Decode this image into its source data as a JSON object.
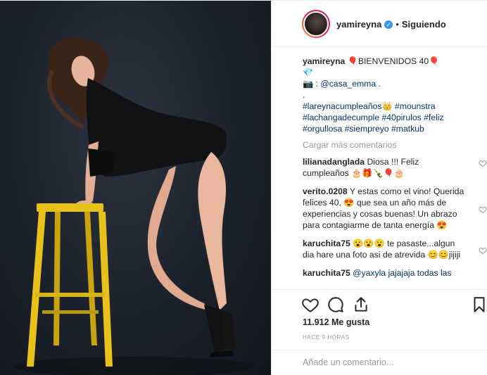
{
  "post": {
    "author": "yamireyna",
    "follow_status": "Siguiendo",
    "dot": "•",
    "caption": {
      "line1": "🎈BIENVENIDOS 40🎈",
      "line2": "💎",
      "line3_prefix": "📷 : ",
      "line3_mention": "@casa_emma",
      "line3_suffix": " .",
      "line4": ".",
      "hashtags_line1a": "#lareynacumpleaños👑",
      "hashtags_line1b": "#mounstra",
      "hashtags_line2a": "#lachangadecumple",
      "hashtags_line2b": "#40pirulos",
      "hashtags_line2c": "#feliz",
      "hashtags_line3a": "#orgullosa",
      "hashtags_line3b": "#siempreyo",
      "hashtags_line3c": "#matkub"
    },
    "load_more": "Cargar más comentarios",
    "comments": [
      {
        "user": "lilianadanglada",
        "text": "Diosa !!! Feliz cumpleaños 🎂🎁🍾🎈🎂"
      },
      {
        "user": "verito.0208",
        "text": "Y estas como el vino! Querida felices 40, 😍 que sea un año más de experiencias y cosas buenas! Un abrazo para contagiarme de tanta energía 😍"
      },
      {
        "user": "karuchita75",
        "text": "😮😮😮 te pasaste...algun dia hare una foto asi de atrevida 😊😊jijiji"
      },
      {
        "user": "karuchita75",
        "text": "@yaxyla jajajaja todas las"
      }
    ],
    "likes": "11.912 Me gusta",
    "time": "HACE 9 HORAS",
    "add_comment_placeholder": "Añade un comentario..."
  },
  "icons": {
    "heart": "heart-icon",
    "comment": "comment-icon",
    "share": "share-icon",
    "save": "bookmark-icon",
    "verified": "verified-badge-icon"
  },
  "colors": {
    "text": "#262626",
    "link": "#003569",
    "muted": "#999999",
    "verified": "#3897f0",
    "stool": "#e8c21a"
  }
}
